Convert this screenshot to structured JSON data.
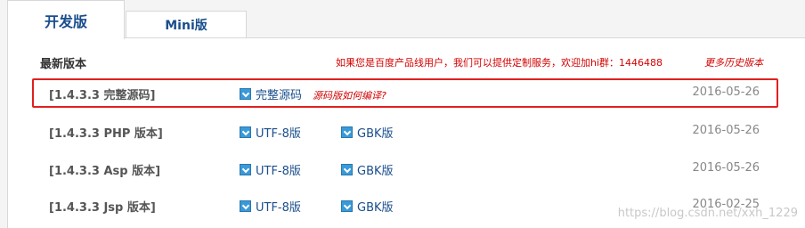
{
  "tabs": {
    "dev": "开发版",
    "mini": "Mini版"
  },
  "header": {
    "title": "最新版本",
    "notice": "如果您是百度产品线用户，我们可以提供定制服务，欢迎加hi群：1446488",
    "more": "更多历史版本"
  },
  "rows": [
    {
      "name": "[1.4.3.3 完整源码]",
      "links": [
        "完整源码"
      ],
      "hint": "源码版如何编译?",
      "date": "2016-05-26"
    },
    {
      "name": "[1.4.3.3 PHP 版本]",
      "links": [
        "UTF-8版",
        "GBK版"
      ],
      "date": "2016-05-26"
    },
    {
      "name": "[1.4.3.3 Asp 版本]",
      "links": [
        "UTF-8版",
        "GBK版"
      ],
      "date": "2016-05-26"
    },
    {
      "name": "[1.4.3.3 Jsp 版本]",
      "links": [
        "UTF-8版",
        "GBK版"
      ],
      "date": "2016-02-25"
    }
  ],
  "watermark": "https://blog.csdn.net/xxh_1229",
  "colors": {
    "link": "#1a4e8c",
    "notice": "#d40000",
    "highlight": "#e02020"
  },
  "icons": {
    "download": "download-arrow-icon"
  }
}
